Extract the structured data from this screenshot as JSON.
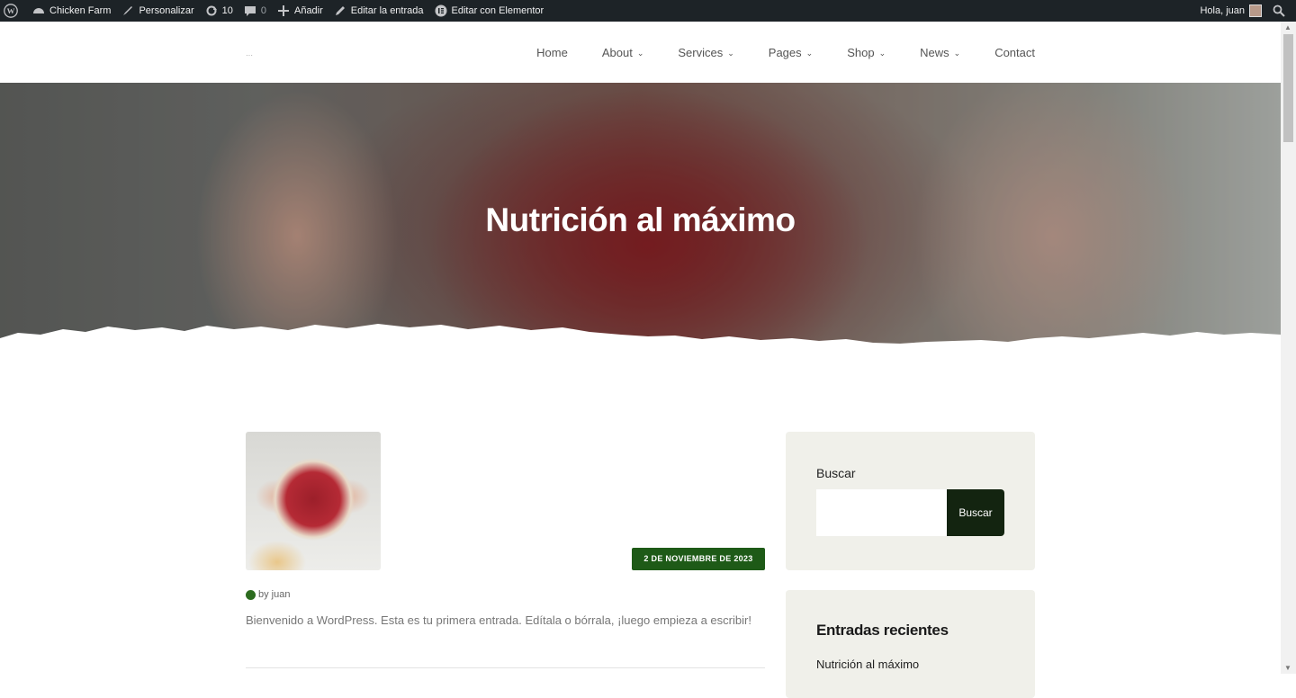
{
  "adminbar": {
    "site_name": "Chicken Farm",
    "customize": "Personalizar",
    "updates_count": "10",
    "comments_count": "0",
    "new": "Añadir",
    "edit_post": "Editar la entrada",
    "edit_elementor": "Editar con Elementor",
    "greeting": "Hola, juan"
  },
  "nav": {
    "items": [
      {
        "label": "Home",
        "dropdown": false
      },
      {
        "label": "About",
        "dropdown": true
      },
      {
        "label": "Services",
        "dropdown": true
      },
      {
        "label": "Pages",
        "dropdown": true
      },
      {
        "label": "Shop",
        "dropdown": true
      },
      {
        "label": "News",
        "dropdown": true
      },
      {
        "label": "Contact",
        "dropdown": false
      }
    ]
  },
  "hero": {
    "title": "Nutrición al máximo"
  },
  "post": {
    "date": "2 DE NOVIEMBRE DE 2023",
    "author": "by juan",
    "excerpt": "Bienvenido a WordPress. Esta es tu primera entrada. Edítala o bórrala, ¡luego empieza a escribir!"
  },
  "sidebar": {
    "search_label": "Buscar",
    "search_value": "",
    "search_button": "Buscar",
    "recent_title": "Entradas recientes",
    "recent_items": [
      "Nutrición al máximo"
    ]
  },
  "colors": {
    "adminbar_bg": "#1d2327",
    "accent_green": "#1e5a17",
    "search_button_bg": "#132410",
    "widget_bg": "#f0f0ea"
  }
}
